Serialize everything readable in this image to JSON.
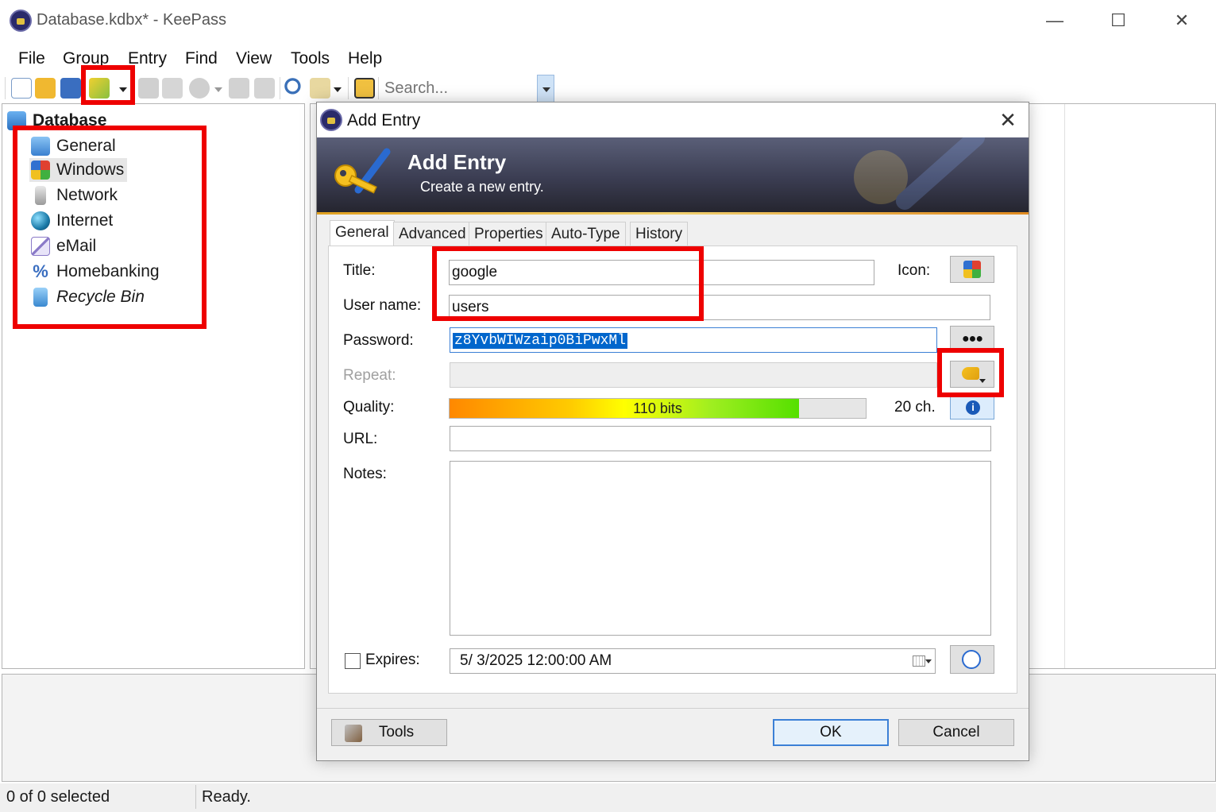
{
  "window": {
    "title": "Database.kdbx* - KeePass",
    "minimize": "—",
    "maximize": "☐",
    "close": "✕"
  },
  "menu": [
    "File",
    "Group",
    "Entry",
    "Find",
    "View",
    "Tools",
    "Help"
  ],
  "toolbar": {
    "search_placeholder": "Search..."
  },
  "tree": {
    "root": "Database",
    "groups": [
      {
        "label": "General",
        "icon": "folder-icon"
      },
      {
        "label": "Windows",
        "icon": "windows-icon"
      },
      {
        "label": "Network",
        "icon": "network-icon"
      },
      {
        "label": "Internet",
        "icon": "globe-icon"
      },
      {
        "label": "eMail",
        "icon": "email-icon"
      },
      {
        "label": "Homebanking",
        "icon": "percent-icon"
      },
      {
        "label": "Recycle Bin",
        "icon": "recycle-bin-icon"
      }
    ]
  },
  "status": {
    "selection": "0 of 0 selected",
    "state": "Ready."
  },
  "dialog": {
    "window_title": "Add Entry",
    "banner_title": "Add Entry",
    "banner_subtitle": "Create a new entry.",
    "tabs": [
      "General",
      "Advanced",
      "Properties",
      "Auto-Type",
      "History"
    ],
    "labels": {
      "title": "Title:",
      "username": "User name:",
      "password": "Password:",
      "repeat": "Repeat:",
      "quality": "Quality:",
      "url": "URL:",
      "notes": "Notes:",
      "icon": "Icon:",
      "expires": "Expires:"
    },
    "values": {
      "title": "google",
      "username": "users",
      "password": "z8YvbWIWzaip0BiPwxMl",
      "url": "",
      "notes": "",
      "expires": "5/  3/2025 12:00:00 AM"
    },
    "quality": {
      "text": "110 bits",
      "chars": "20 ch.",
      "fraction": 0.84
    },
    "buttons": {
      "hide_password": "●●●",
      "tools": "Tools",
      "ok": "OK",
      "cancel": "Cancel"
    }
  },
  "colors": {
    "highlight": "#ee0000",
    "accent": "#0066cc",
    "banner_dark": "#25252f"
  }
}
